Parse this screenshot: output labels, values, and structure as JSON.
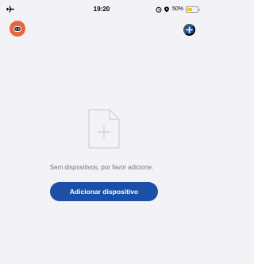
{
  "status_bar": {
    "time": "19:20",
    "battery_text": "50%",
    "battery_level": 0.5,
    "icons": [
      "airplane-icon",
      "alarm-icon",
      "location-icon",
      "battery-icon"
    ]
  },
  "header": {
    "avatar_icon": "robot-avatar-icon",
    "add_icon": "plus-circle-icon"
  },
  "empty_state": {
    "icon": "add-document-icon",
    "message": "Sem dispositivos, por favor adicione.",
    "button_label": "Adicionar dispositivo"
  },
  "colors": {
    "primary": "#1c4fa8",
    "avatar": "#e8663d",
    "background": "#f2f2f7",
    "muted_text": "#7a7a7a"
  }
}
